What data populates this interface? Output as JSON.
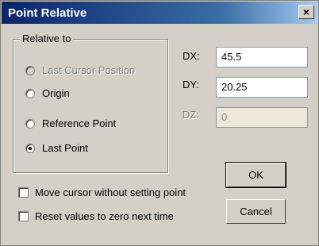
{
  "window": {
    "title": "Point Relative",
    "close_glyph": "×"
  },
  "relative_to": {
    "legend": "Relative to",
    "options": [
      {
        "label": "Last Cursor Position",
        "checked": false,
        "disabled": true
      },
      {
        "label": "Origin",
        "checked": false,
        "disabled": false
      },
      {
        "label": "Reference Point",
        "checked": false,
        "disabled": false
      },
      {
        "label": "Last Point",
        "checked": true,
        "disabled": false
      }
    ]
  },
  "fields": {
    "dx": {
      "label": "DX:",
      "value": "45.5"
    },
    "dy": {
      "label": "DY:",
      "value": "20.25"
    },
    "dz": {
      "label": "DZ:",
      "value": "0",
      "disabled": true
    }
  },
  "checkboxes": {
    "move_cursor": {
      "label": "Move cursor without setting point",
      "checked": false
    },
    "reset_values": {
      "label": "Reset values to zero next time",
      "checked": false
    }
  },
  "buttons": {
    "ok": "OK",
    "cancel": "Cancel"
  }
}
